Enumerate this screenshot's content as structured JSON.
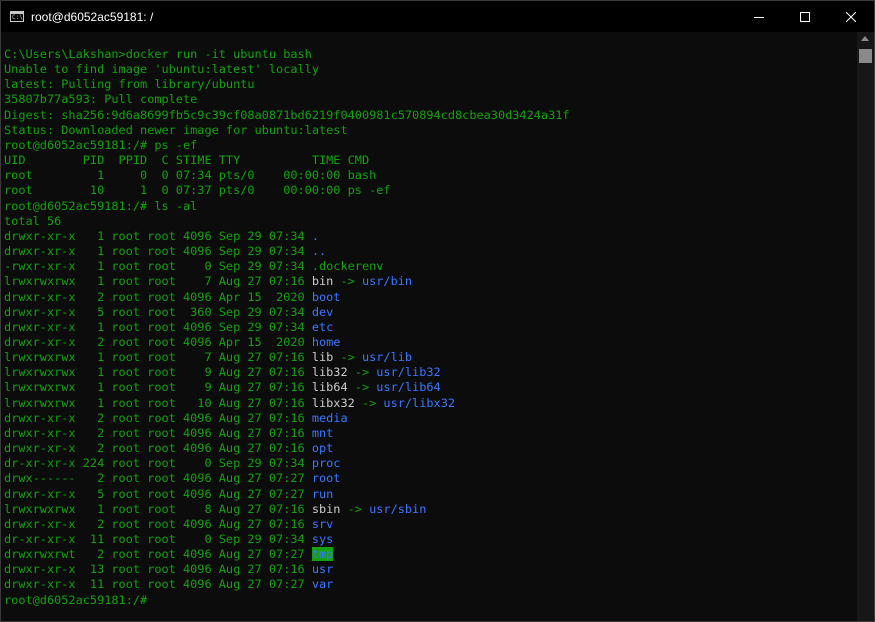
{
  "window": {
    "title": "root@d6052ac59181: /",
    "icon": "console-icon",
    "icon_label": "C:\\",
    "controls": [
      "minimize-icon",
      "maximize-icon",
      "close-icon"
    ]
  },
  "colors": {
    "background": "#0c0c0c",
    "text_green": "#13a10e",
    "text_white": "#cccccc",
    "text_blue": "#3b78ff",
    "highlight_bg": "#13a10e"
  },
  "terminal": {
    "lines": [
      [
        {
          "t": "C:\\Users\\Lakshan>docker run -it ubuntu bash",
          "c": "green"
        }
      ],
      [
        {
          "t": "Unable to find image 'ubuntu:latest' locally",
          "c": "green"
        }
      ],
      [
        {
          "t": "latest: Pulling from library/ubuntu",
          "c": "green"
        }
      ],
      [
        {
          "t": "35807b77a593: Pull complete",
          "c": "green"
        }
      ],
      [
        {
          "t": "Digest: sha256:9d6a8699fb5c9c39cf08a0871bd6219f0400981c570894cd8cbea30d3424a31f",
          "c": "green"
        }
      ],
      [
        {
          "t": "Status: Downloaded newer image for ubuntu:latest",
          "c": "green"
        }
      ],
      [
        {
          "t": "root@d6052ac59181:/# ps -ef",
          "c": "green"
        }
      ],
      [
        {
          "t": "UID        PID  PPID  C STIME TTY          TIME CMD",
          "c": "green"
        }
      ],
      [
        {
          "t": "root         1     0  0 07:34 pts/0    00:00:00 bash",
          "c": "green"
        }
      ],
      [
        {
          "t": "root        10     1  0 07:37 pts/0    00:00:00 ps -ef",
          "c": "green"
        }
      ],
      [
        {
          "t": "root@d6052ac59181:/# ls -al",
          "c": "green"
        }
      ],
      [
        {
          "t": "total 56",
          "c": "green"
        }
      ],
      [
        {
          "t": "drwxr-xr-x   1 root root 4096 Sep 29 07:34 ",
          "c": "green"
        },
        {
          "t": ".",
          "c": "blue"
        }
      ],
      [
        {
          "t": "drwxr-xr-x   1 root root 4096 Sep 29 07:34 ",
          "c": "green"
        },
        {
          "t": "..",
          "c": "blue"
        }
      ],
      [
        {
          "t": "-rwxr-xr-x   1 root root    0 Sep 29 07:34 .dockerenv",
          "c": "green"
        }
      ],
      [
        {
          "t": "lrwxrwxrwx   1 root root    7 Aug 27 07:16 ",
          "c": "green"
        },
        {
          "t": "bin",
          "c": "white"
        },
        {
          "t": " -> ",
          "c": "green"
        },
        {
          "t": "usr/bin",
          "c": "blue"
        }
      ],
      [
        {
          "t": "drwxr-xr-x   2 root root 4096 Apr 15  2020 ",
          "c": "green"
        },
        {
          "t": "boot",
          "c": "blue"
        }
      ],
      [
        {
          "t": "drwxr-xr-x   5 root root  360 Sep 29 07:34 ",
          "c": "green"
        },
        {
          "t": "dev",
          "c": "blue"
        }
      ],
      [
        {
          "t": "drwxr-xr-x   1 root root 4096 Sep 29 07:34 ",
          "c": "green"
        },
        {
          "t": "etc",
          "c": "blue"
        }
      ],
      [
        {
          "t": "drwxr-xr-x   2 root root 4096 Apr 15  2020 ",
          "c": "green"
        },
        {
          "t": "home",
          "c": "blue"
        }
      ],
      [
        {
          "t": "lrwxrwxrwx   1 root root    7 Aug 27 07:16 ",
          "c": "green"
        },
        {
          "t": "lib",
          "c": "white"
        },
        {
          "t": " -> ",
          "c": "green"
        },
        {
          "t": "usr/lib",
          "c": "blue"
        }
      ],
      [
        {
          "t": "lrwxrwxrwx   1 root root    9 Aug 27 07:16 ",
          "c": "green"
        },
        {
          "t": "lib32",
          "c": "white"
        },
        {
          "t": " -> ",
          "c": "green"
        },
        {
          "t": "usr/lib32",
          "c": "blue"
        }
      ],
      [
        {
          "t": "lrwxrwxrwx   1 root root    9 Aug 27 07:16 ",
          "c": "green"
        },
        {
          "t": "lib64",
          "c": "white"
        },
        {
          "t": " -> ",
          "c": "green"
        },
        {
          "t": "usr/lib64",
          "c": "blue"
        }
      ],
      [
        {
          "t": "lrwxrwxrwx   1 root root   10 Aug 27 07:16 ",
          "c": "green"
        },
        {
          "t": "libx32",
          "c": "white"
        },
        {
          "t": " -> ",
          "c": "green"
        },
        {
          "t": "usr/libx32",
          "c": "blue"
        }
      ],
      [
        {
          "t": "drwxr-xr-x   2 root root 4096 Aug 27 07:16 ",
          "c": "green"
        },
        {
          "t": "media",
          "c": "blue"
        }
      ],
      [
        {
          "t": "drwxr-xr-x   2 root root 4096 Aug 27 07:16 ",
          "c": "green"
        },
        {
          "t": "mnt",
          "c": "blue"
        }
      ],
      [
        {
          "t": "drwxr-xr-x   2 root root 4096 Aug 27 07:16 ",
          "c": "green"
        },
        {
          "t": "opt",
          "c": "blue"
        }
      ],
      [
        {
          "t": "dr-xr-xr-x 224 root root    0 Sep 29 07:34 ",
          "c": "green"
        },
        {
          "t": "proc",
          "c": "blue"
        }
      ],
      [
        {
          "t": "drwx------   2 root root 4096 Aug 27 07:27 ",
          "c": "green"
        },
        {
          "t": "root",
          "c": "blue"
        }
      ],
      [
        {
          "t": "drwxr-xr-x   5 root root 4096 Aug 27 07:27 ",
          "c": "green"
        },
        {
          "t": "run",
          "c": "blue"
        }
      ],
      [
        {
          "t": "lrwxrwxrwx   1 root root    8 Aug 27 07:16 ",
          "c": "green"
        },
        {
          "t": "sbin",
          "c": "white"
        },
        {
          "t": " -> ",
          "c": "green"
        },
        {
          "t": "usr/sbin",
          "c": "blue"
        }
      ],
      [
        {
          "t": "drwxr-xr-x   2 root root 4096 Aug 27 07:16 ",
          "c": "green"
        },
        {
          "t": "srv",
          "c": "blue"
        }
      ],
      [
        {
          "t": "dr-xr-xr-x  11 root root    0 Sep 29 07:34 ",
          "c": "green"
        },
        {
          "t": "sys",
          "c": "blue"
        }
      ],
      [
        {
          "t": "drwxrwxrwt   2 root root 4096 Aug 27 07:27 ",
          "c": "green"
        },
        {
          "t": "tmp",
          "c": "highlight"
        }
      ],
      [
        {
          "t": "drwxr-xr-x  13 root root 4096 Aug 27 07:16 ",
          "c": "green"
        },
        {
          "t": "usr",
          "c": "blue"
        }
      ],
      [
        {
          "t": "drwxr-xr-x  11 root root 4096 Aug 27 07:27 ",
          "c": "green"
        },
        {
          "t": "var",
          "c": "blue"
        }
      ],
      [
        {
          "t": "root@d6052ac59181:/#",
          "c": "green"
        }
      ]
    ]
  }
}
